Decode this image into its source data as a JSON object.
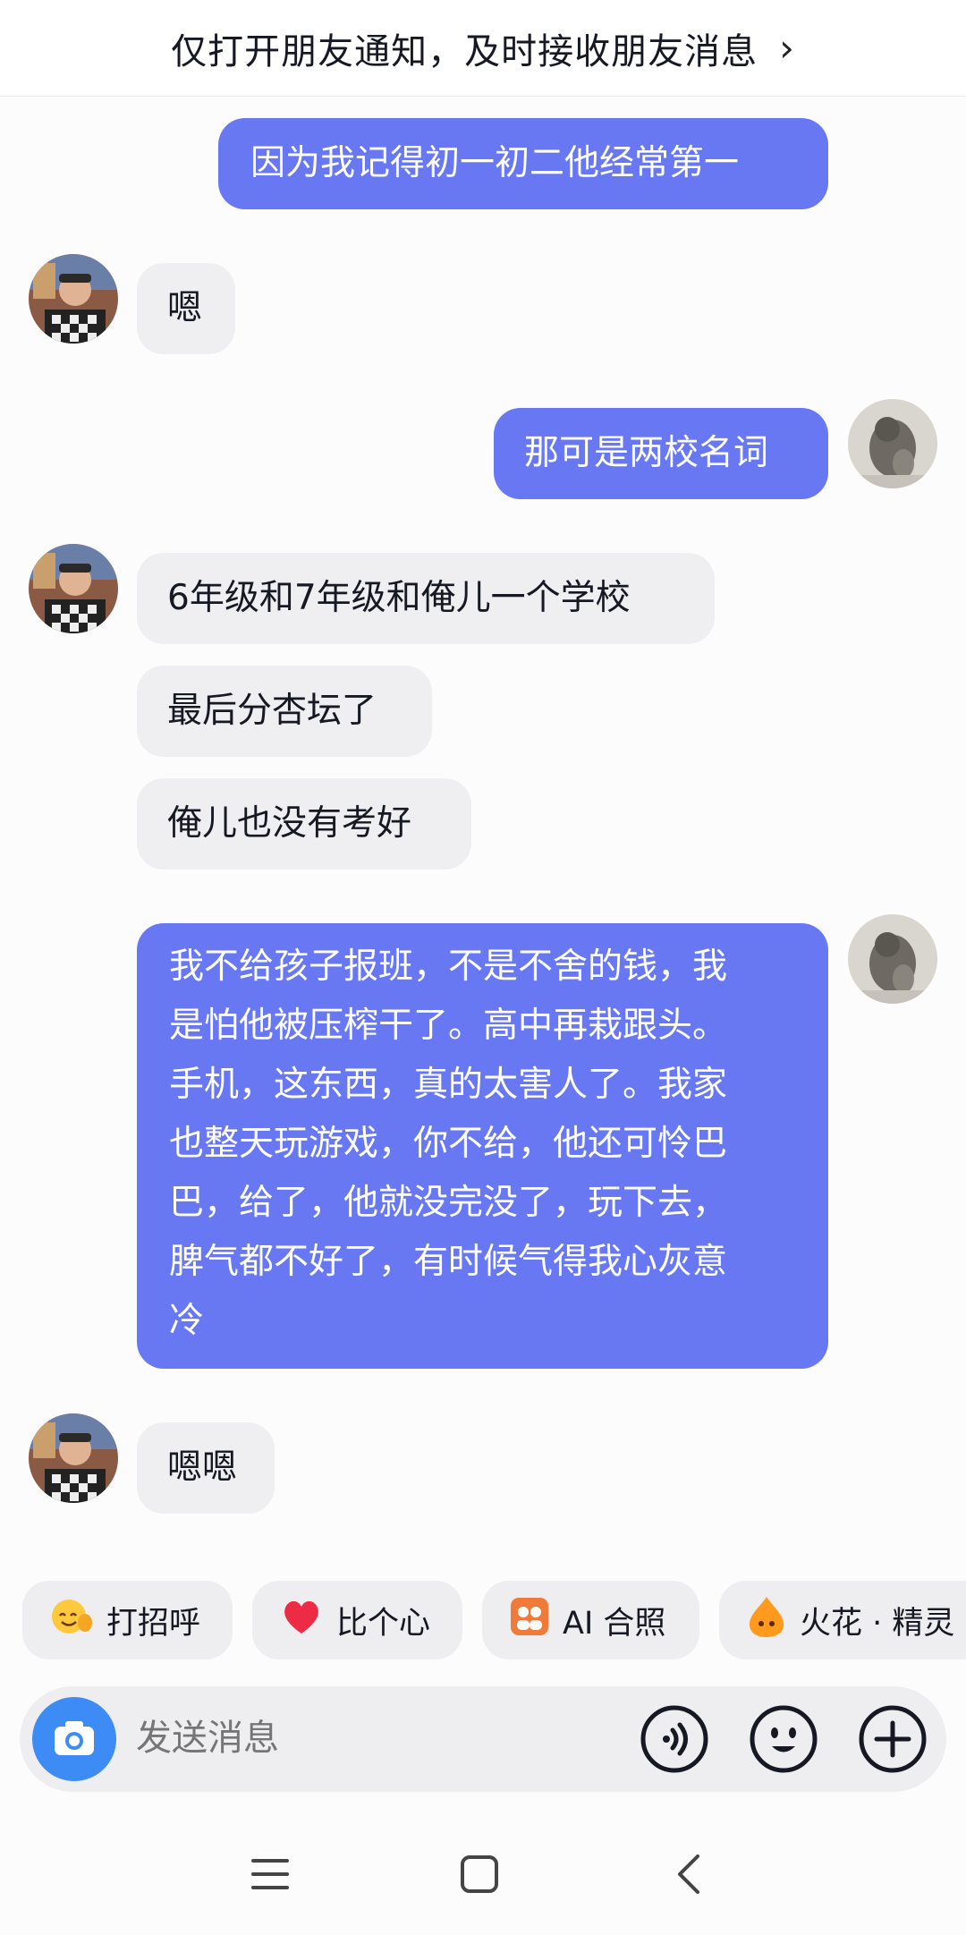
{
  "banner": {
    "text": "仅打开朋友通知，及时接收朋友消息",
    "chevron": "›"
  },
  "messages": {
    "m1": "因为我记得初一初二他经常第一",
    "m2": "嗯",
    "m3": "那可是两校名词",
    "m4": "6年级和7年级和俺儿一个学校",
    "m5": "最后分杏坛了",
    "m6": "俺儿也没有考好",
    "m7_lines": [
      "我不给孩子报班，不是不舍的钱，我",
      "是怕他被压榨干了。高中再栽跟头。",
      "手机，这东西，真的太害人了。我家",
      "也整天玩游戏，你不给，他还可怜巴",
      "巴，给了，他就没完没了，玩下去，",
      "脾气都不好了，有时候气得我心灰意",
      "冷"
    ],
    "m8": "嗯嗯"
  },
  "chips": {
    "greet": {
      "label": "打招呼",
      "icon": "waving-emoji-icon"
    },
    "heart": {
      "label": "比个心",
      "icon": "red-heart-icon"
    },
    "ai": {
      "label": "AI 合照",
      "icon": "ai-photo-icon"
    },
    "spark": {
      "label": "火花 · 精灵",
      "icon": "spark-sprite-icon"
    }
  },
  "input": {
    "placeholder": "发送消息"
  },
  "colors": {
    "outgoing_bubble": "#6878f3",
    "incoming_bubble": "#efeff1",
    "camera_button": "#3d8cf5"
  }
}
